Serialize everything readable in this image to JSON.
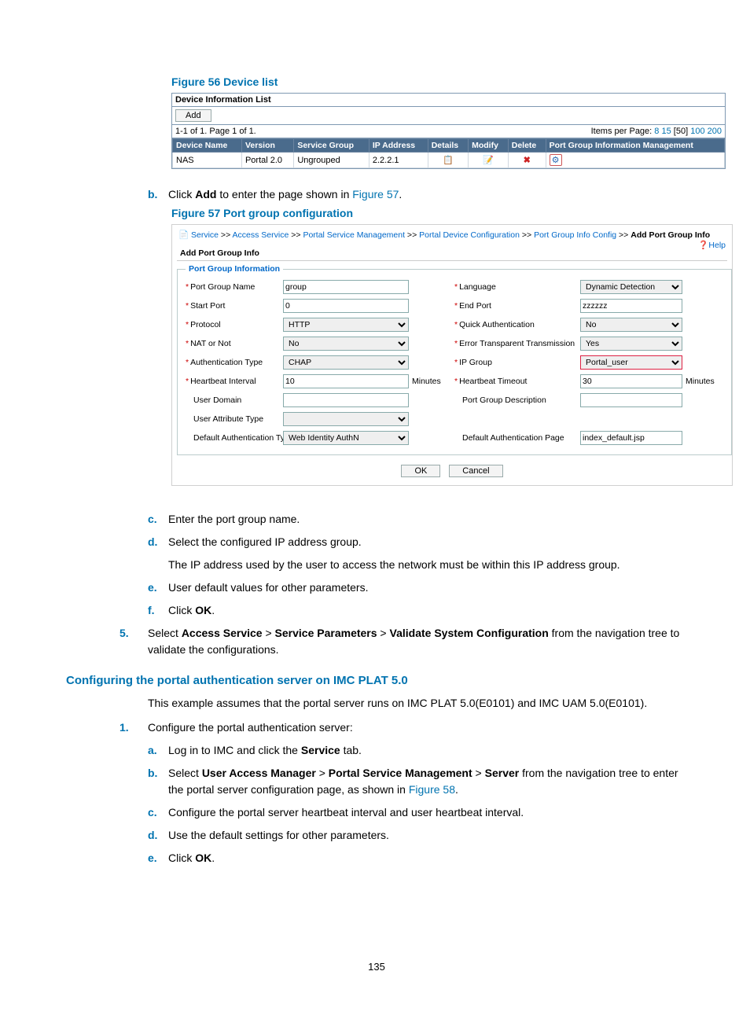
{
  "figure56": {
    "title": "Figure 56 Device list",
    "table_title": "Device Information List",
    "add_button": "Add",
    "pagination_left": "1-1 of 1. Page 1 of 1.",
    "ipp_label": "Items per Page:",
    "ipp_options": [
      "8",
      "15",
      "[50]",
      "100",
      "200"
    ],
    "columns": [
      "Device Name",
      "Version",
      "Service Group",
      "IP Address",
      "Details",
      "Modify",
      "Delete",
      "Port Group Information Management"
    ],
    "row": {
      "device_name": "NAS",
      "version": "Portal 2.0",
      "service_group": "Ungrouped",
      "ip_address": "2.2.2.1"
    }
  },
  "step_b": {
    "letter": "b.",
    "pre": "Click ",
    "bold": "Add",
    "post": " to enter the page shown in ",
    "link": "Figure 57",
    "end": "."
  },
  "figure57": {
    "title": "Figure 57 Port group configuration",
    "breadcrumb": {
      "items": [
        "Service",
        "Access Service",
        "Portal Service Management",
        "Portal Device Configuration",
        "Port Group Info Config"
      ],
      "current": "Add Port Group Info",
      "help": "Help"
    },
    "section_title": "Add Port Group Info",
    "legend": "Port Group Information",
    "fields": {
      "port_group_name": {
        "label": "Port Group Name",
        "value": "group"
      },
      "language": {
        "label": "Language",
        "value": "Dynamic Detection"
      },
      "start_port": {
        "label": "Start Port",
        "value": "0"
      },
      "end_port": {
        "label": "End Port",
        "value": "zzzzzz"
      },
      "protocol": {
        "label": "Protocol",
        "value": "HTTP"
      },
      "quick_auth": {
        "label": "Quick Authentication",
        "value": "No"
      },
      "nat_or_not": {
        "label": "NAT or Not",
        "value": "No"
      },
      "error_trans": {
        "label": "Error Transparent Transmission",
        "value": "Yes"
      },
      "auth_type": {
        "label": "Authentication Type",
        "value": "CHAP"
      },
      "ip_group": {
        "label": "IP Group",
        "value": "Portal_user"
      },
      "heartbeat_interval": {
        "label": "Heartbeat Interval",
        "value": "10",
        "unit": "Minutes"
      },
      "heartbeat_timeout": {
        "label": "Heartbeat Timeout",
        "value": "30",
        "unit": "Minutes"
      },
      "user_domain": {
        "label": "User Domain",
        "value": ""
      },
      "port_group_desc": {
        "label": "Port Group Description",
        "value": ""
      },
      "user_attr_type": {
        "label": "User Attribute Type",
        "value": ""
      },
      "default_auth_type": {
        "label": "Default Authentication Type",
        "value": "Web Identity AuthN"
      },
      "default_auth_page": {
        "label": "Default Authentication Page",
        "value": "index_default.jsp"
      }
    },
    "ok": "OK",
    "cancel": "Cancel"
  },
  "steps_cf": {
    "c": {
      "letter": "c.",
      "text": "Enter the port group name."
    },
    "d": {
      "letter": "d.",
      "text": "Select the configured IP address group.",
      "cont": "The IP address used by the user to access the network must be within this IP address group."
    },
    "e": {
      "letter": "e.",
      "text": "User default values for other parameters."
    },
    "f": {
      "letter": "f.",
      "pre": "Click ",
      "bold": "OK",
      "post": "."
    }
  },
  "step5": {
    "num": "5.",
    "pre": "Select ",
    "b1": "Access Service",
    "sep": " > ",
    "b2": "Service Parameters",
    "b3": "Validate System Configuration",
    "post": " from the navigation tree to validate the configurations."
  },
  "h4": "Configuring the portal authentication server on IMC PLAT 5.0",
  "para": "This example assumes that the portal server runs on IMC PLAT 5.0(E0101) and IMC UAM 5.0(E0101).",
  "step1": {
    "num": "1.",
    "text": "Configure the portal authentication server:"
  },
  "steps_ae": {
    "a": {
      "letter": "a.",
      "pre": "Log in to IMC and click the ",
      "bold": "Service",
      "post": " tab."
    },
    "b": {
      "letter": "b.",
      "pre": "Select ",
      "b1": "User Access Manager",
      "sep": " > ",
      "b2": "Portal Service Management",
      "b3": "Server",
      "post1": " from the navigation tree to enter the portal server configuration page, as shown in ",
      "link": "Figure 58",
      "post2": "."
    },
    "c": {
      "letter": "c.",
      "text": "Configure the portal server heartbeat interval and user heartbeat interval."
    },
    "d": {
      "letter": "d.",
      "text": "Use the default settings for other parameters."
    },
    "e": {
      "letter": "e.",
      "pre": "Click ",
      "bold": "OK",
      "post": "."
    }
  },
  "page_number": "135"
}
